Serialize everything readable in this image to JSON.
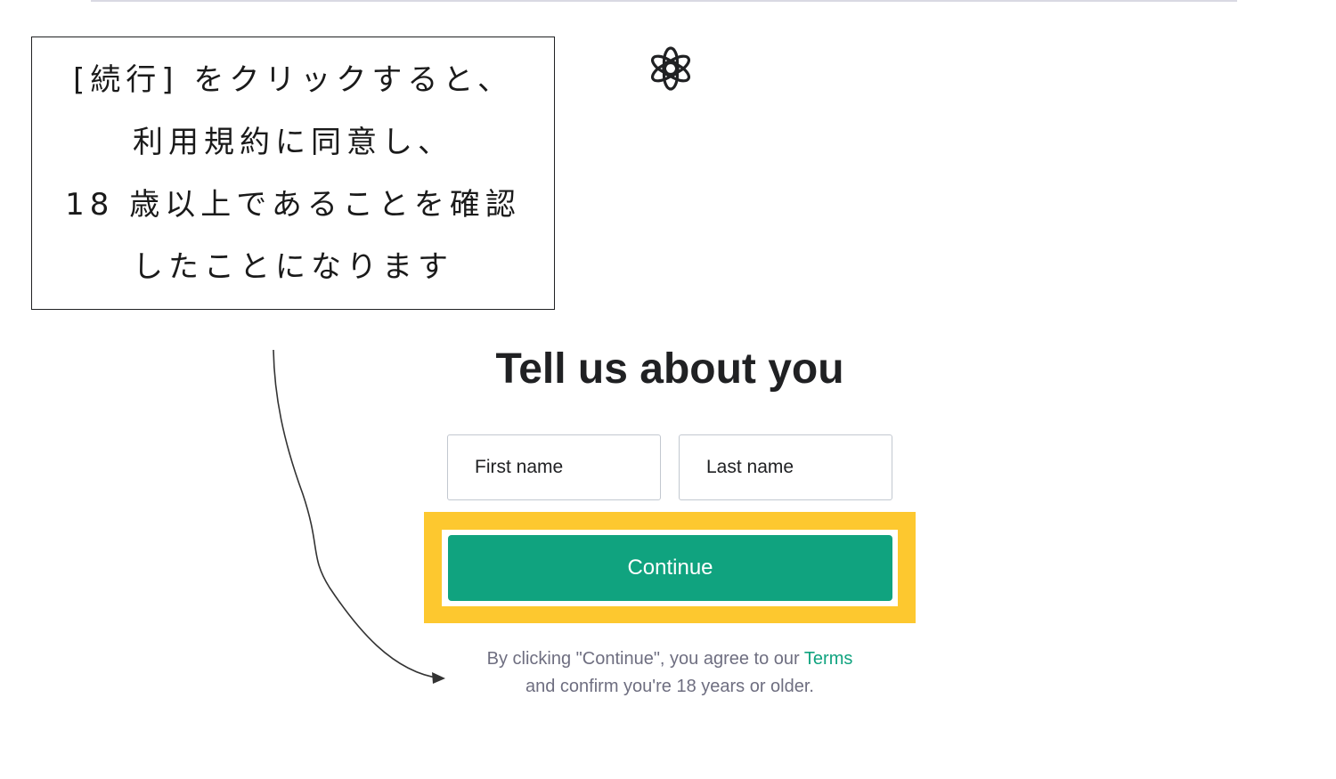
{
  "annotation": {
    "lines": [
      "[続行] をクリックすると、",
      "利用規約に同意し、",
      "18 歳以上であることを確認",
      "したことになります"
    ]
  },
  "logo": {
    "icon": "openai-logo-icon"
  },
  "signup": {
    "title": "Tell us about you",
    "first_name_placeholder": "First name",
    "last_name_placeholder": "Last name",
    "continue_label": "Continue",
    "legal_prefix": "By clicking \"Continue\", you agree to our",
    "terms_link": "Terms",
    "legal_suffix": "and confirm you're 18 years or older."
  },
  "colors": {
    "brand_green": "#10a37f",
    "highlight_yellow": "#fdc82f",
    "muted_text": "#6e6e80"
  }
}
